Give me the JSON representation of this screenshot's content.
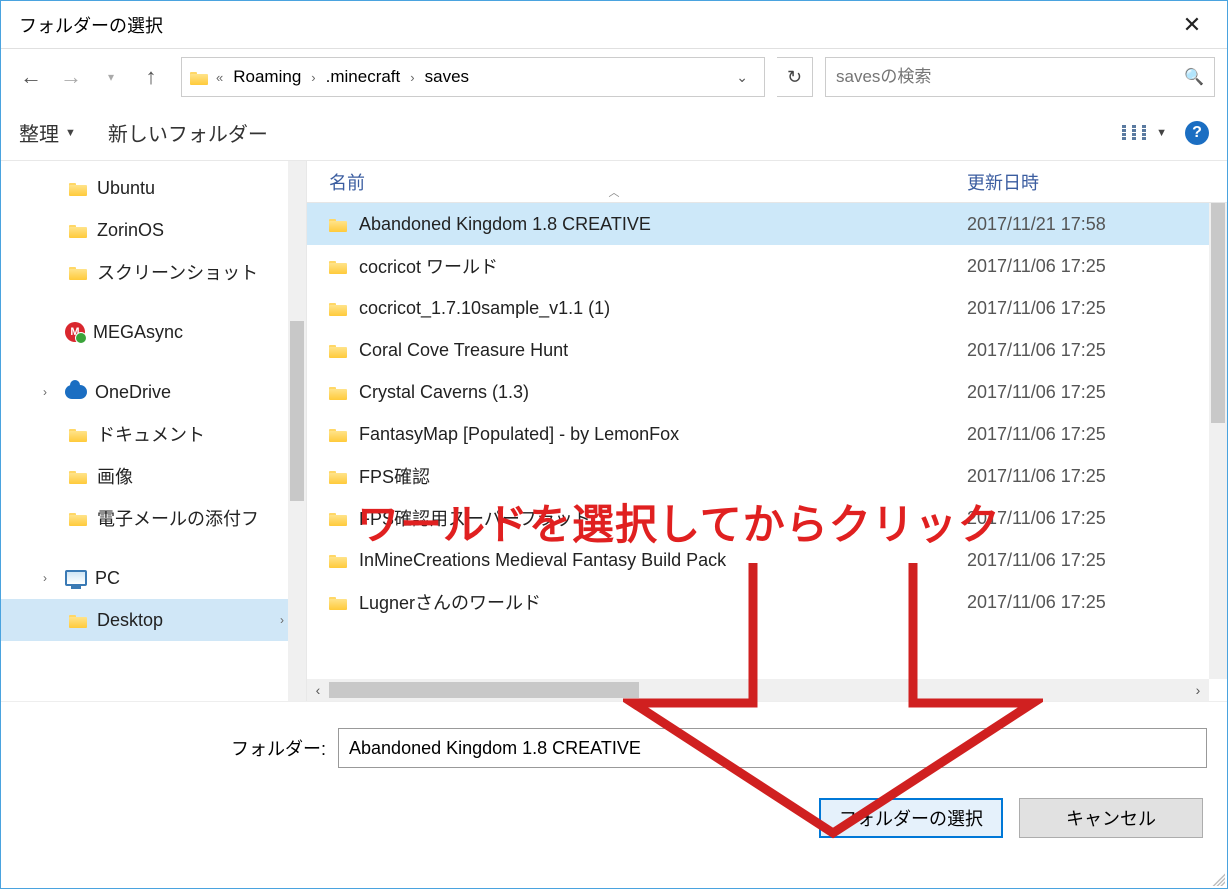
{
  "title": "フォルダーの選択",
  "breadcrumbs": [
    "Roaming",
    ".minecraft",
    "saves"
  ],
  "search_placeholder": "savesの検索",
  "toolbar": {
    "organize": "整理",
    "new_folder": "新しいフォルダー"
  },
  "columns": {
    "name": "名前",
    "date": "更新日時"
  },
  "sidebar": {
    "items": [
      {
        "label": "Ubuntu",
        "icon": "folder",
        "indent": 1
      },
      {
        "label": "ZorinOS",
        "icon": "folder",
        "indent": 1
      },
      {
        "label": "スクリーンショット",
        "icon": "folder",
        "indent": 1
      },
      {
        "label": "MEGAsync",
        "icon": "mega",
        "indent": 0,
        "root": true
      },
      {
        "label": "OneDrive",
        "icon": "cloud",
        "indent": 0,
        "root": true,
        "expand": true
      },
      {
        "label": "ドキュメント",
        "icon": "folder",
        "indent": 1
      },
      {
        "label": "画像",
        "icon": "folder",
        "indent": 1
      },
      {
        "label": "電子メールの添付フ",
        "icon": "folder",
        "indent": 1
      },
      {
        "label": "PC",
        "icon": "pc",
        "indent": 0,
        "root": true,
        "expand": true
      },
      {
        "label": "Desktop",
        "icon": "folder",
        "indent": 1,
        "selected": true,
        "expand": true
      }
    ]
  },
  "files": [
    {
      "name": "Abandoned Kingdom 1.8 CREATIVE",
      "date": "2017/11/21 17:58",
      "selected": true
    },
    {
      "name": "cocricot ワールド",
      "date": "2017/11/06 17:25"
    },
    {
      "name": "cocricot_1.7.10sample_v1.1 (1)",
      "date": "2017/11/06 17:25"
    },
    {
      "name": "Coral Cove Treasure Hunt",
      "date": "2017/11/06 17:25"
    },
    {
      "name": "Crystal Caverns (1.3)",
      "date": "2017/11/06 17:25"
    },
    {
      "name": "FantasyMap [Populated] - by LemonFox",
      "date": "2017/11/06 17:25"
    },
    {
      "name": "FPS確認",
      "date": "2017/11/06 17:25"
    },
    {
      "name": "FPS確認用スーパーフラット",
      "date": "2017/11/06 17:25"
    },
    {
      "name": "InMineCreations Medieval Fantasy Build Pack",
      "date": "2017/11/06 17:25"
    },
    {
      "name": "Lugnerさんのワールド",
      "date": "2017/11/06 17:25"
    }
  ],
  "folder_label": "フォルダー:",
  "folder_value": "Abandoned Kingdom 1.8 CREATIVE",
  "buttons": {
    "select": "フォルダーの選択",
    "cancel": "キャンセル"
  },
  "annotation": "ワールドを選択してからクリック"
}
